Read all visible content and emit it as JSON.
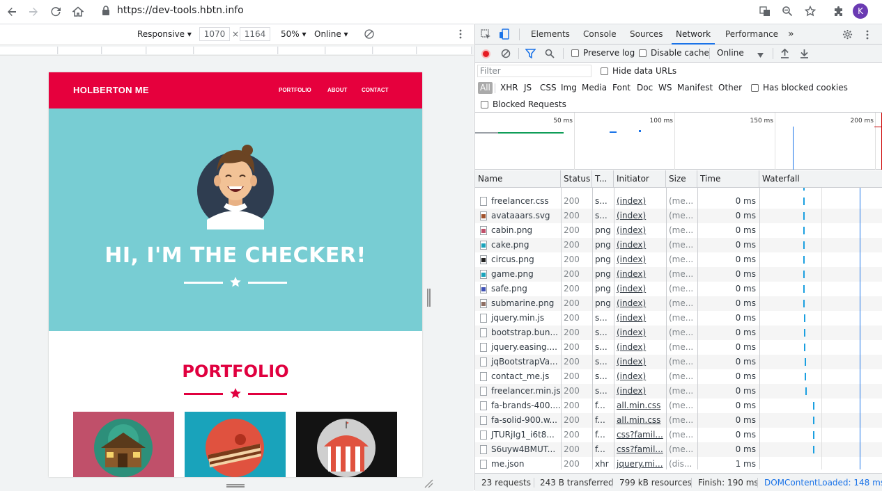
{
  "browser": {
    "url": "https://dev-tools.hbtn.info",
    "profile_initial": "K"
  },
  "device_toolbar": {
    "mode": "Responsive",
    "width": "1070",
    "times": "×",
    "height": "1164",
    "zoom": "50%",
    "network": "Online"
  },
  "site": {
    "brand": "HOLBERTON ME",
    "nav": [
      "PORTFOLIO",
      "ABOUT",
      "CONTACT"
    ],
    "hero_title": "HI, I'M THE CHECKER!",
    "portfolio_title": "PORTFOLIO",
    "colors": {
      "nav": "#e6003d",
      "hero": "#78cdd3",
      "accent": "#e0003f"
    }
  },
  "devtools": {
    "tabs": [
      "Elements",
      "Console",
      "Sources",
      "Network",
      "Performance"
    ],
    "active_tab": "Network",
    "more_tabs": "»",
    "toolbar": {
      "preserve_log": "Preserve log",
      "disable_cache": "Disable cache",
      "throttle": "Online"
    },
    "filter": {
      "placeholder": "Filter",
      "hide_data_urls": "Hide data URLs",
      "types": [
        "All",
        "XHR",
        "JS",
        "CSS",
        "Img",
        "Media",
        "Font",
        "Doc",
        "WS",
        "Manifest",
        "Other"
      ],
      "has_blocked_cookies": "Has blocked cookies",
      "blocked_requests": "Blocked Requests"
    },
    "overview_ticks": [
      "50 ms",
      "100 ms",
      "150 ms",
      "200 ms"
    ],
    "columns": [
      "Name",
      "Status",
      "T...",
      "Initiator",
      "Size",
      "Time",
      "Waterfall"
    ],
    "rows": [
      {
        "name": "freelancer.css",
        "status": "200",
        "type": "s...",
        "initiator": "(index)",
        "size": "(me...",
        "time": "0 ms",
        "icon": "doc",
        "wf": 62
      },
      {
        "name": "avataaars.svg",
        "status": "200",
        "type": "s...",
        "initiator": "(index)",
        "size": "(me...",
        "time": "0 ms",
        "icon": "img-avatar",
        "wf": 62
      },
      {
        "name": "cabin.png",
        "status": "200",
        "type": "png",
        "initiator": "(index)",
        "size": "(me...",
        "time": "0 ms",
        "icon": "img-red",
        "wf": 62
      },
      {
        "name": "cake.png",
        "status": "200",
        "type": "png",
        "initiator": "(index)",
        "size": "(me...",
        "time": "0 ms",
        "icon": "img-teal",
        "wf": 62
      },
      {
        "name": "circus.png",
        "status": "200",
        "type": "png",
        "initiator": "(index)",
        "size": "(me...",
        "time": "0 ms",
        "icon": "img-dark",
        "wf": 62
      },
      {
        "name": "game.png",
        "status": "200",
        "type": "png",
        "initiator": "(index)",
        "size": "(me...",
        "time": "0 ms",
        "icon": "img-teal",
        "wf": 62
      },
      {
        "name": "safe.png",
        "status": "200",
        "type": "png",
        "initiator": "(index)",
        "size": "(me...",
        "time": "0 ms",
        "icon": "img-blue",
        "wf": 62
      },
      {
        "name": "submarine.png",
        "status": "200",
        "type": "png",
        "initiator": "(index)",
        "size": "(me...",
        "time": "0 ms",
        "icon": "img-brown",
        "wf": 62
      },
      {
        "name": "jquery.min.js",
        "status": "200",
        "type": "s...",
        "initiator": "(index)",
        "size": "(me...",
        "time": "0 ms",
        "icon": "doc",
        "wf": 63
      },
      {
        "name": "bootstrap.bun...",
        "status": "200",
        "type": "s...",
        "initiator": "(index)",
        "size": "(me...",
        "time": "0 ms",
        "icon": "doc",
        "wf": 63
      },
      {
        "name": "jquery.easing....",
        "status": "200",
        "type": "s...",
        "initiator": "(index)",
        "size": "(me...",
        "time": "0 ms",
        "icon": "doc",
        "wf": 63
      },
      {
        "name": "jqBootstrapVa...",
        "status": "200",
        "type": "s...",
        "initiator": "(index)",
        "size": "(me...",
        "time": "0 ms",
        "icon": "doc",
        "wf": 64
      },
      {
        "name": "contact_me.js",
        "status": "200",
        "type": "s...",
        "initiator": "(index)",
        "size": "(me...",
        "time": "0 ms",
        "icon": "doc",
        "wf": 64
      },
      {
        "name": "freelancer.min.js",
        "status": "200",
        "type": "s...",
        "initiator": "(index)",
        "size": "(me...",
        "time": "0 ms",
        "icon": "doc",
        "wf": 65
      },
      {
        "name": "fa-brands-400....",
        "status": "200",
        "type": "f...",
        "initiator": "all.min.css",
        "size": "(me...",
        "time": "0 ms",
        "icon": "doc",
        "wf": 76
      },
      {
        "name": "fa-solid-900.w...",
        "status": "200",
        "type": "f...",
        "initiator": "all.min.css",
        "size": "(me...",
        "time": "0 ms",
        "icon": "doc",
        "wf": 76
      },
      {
        "name": "JTURjIg1_i6t8...",
        "status": "200",
        "type": "f...",
        "initiator": "css?famil...",
        "size": "(me...",
        "time": "0 ms",
        "icon": "doc",
        "wf": 76
      },
      {
        "name": "S6uyw4BMUT...",
        "status": "200",
        "type": "f...",
        "initiator": "css?famil...",
        "size": "(me...",
        "time": "0 ms",
        "icon": "doc",
        "wf": 76
      },
      {
        "name": "me.json",
        "status": "200",
        "type": "xhr",
        "initiator": "jquery.mi...",
        "size": "(dis...",
        "time": "1 ms",
        "icon": "doc",
        "wf": 0
      }
    ],
    "status": {
      "requests": "23 requests",
      "transferred": "243 B transferred",
      "resources": "799 kB resources",
      "finish": "Finish: 190 ms",
      "dcl": "DOMContentLoaded: 148 ms"
    }
  }
}
